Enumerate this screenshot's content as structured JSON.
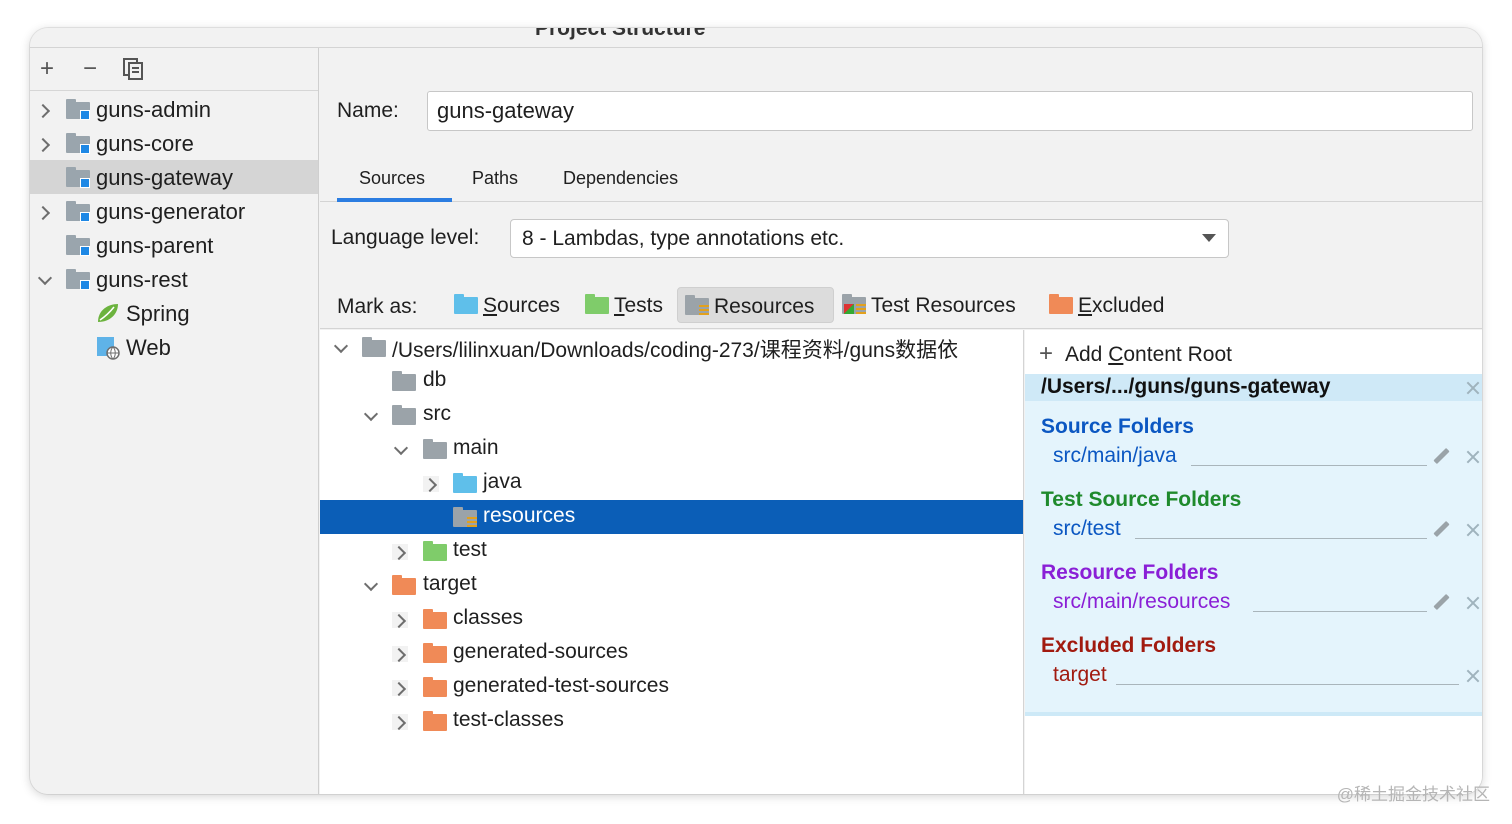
{
  "window": {
    "title": "Project Structure"
  },
  "left_toolbar": {
    "add": "+",
    "remove": "−"
  },
  "modules": [
    {
      "label": "guns-admin"
    },
    {
      "label": "guns-core"
    },
    {
      "label": "guns-gateway",
      "selected": true
    },
    {
      "label": "guns-generator"
    },
    {
      "label": "guns-parent"
    },
    {
      "label": "guns-rest"
    },
    {
      "label": "Spring"
    },
    {
      "label": "Web"
    }
  ],
  "name_field": {
    "label": "Name:",
    "value": "guns-gateway"
  },
  "tabs": [
    {
      "label": "Sources",
      "active": true
    },
    {
      "label": "Paths"
    },
    {
      "label": "Dependencies"
    }
  ],
  "language_level": {
    "label": "Language level:",
    "value": "8 - Lambdas, type annotations etc."
  },
  "mark_as": {
    "label": "Mark as:",
    "buttons": [
      {
        "mnemonic": "S",
        "rest": "ources"
      },
      {
        "mnemonic": "T",
        "rest": "ests"
      },
      {
        "mnemonic": "",
        "rest": "Resources",
        "active": true
      },
      {
        "mnemonic": "",
        "rest": "Test Resources"
      },
      {
        "mnemonic": "E",
        "rest": "xcluded"
      }
    ]
  },
  "tree": [
    {
      "label": "/Users/lilinxuan/Downloads/coding-273/课程资料/guns数据依"
    },
    {
      "label": "db"
    },
    {
      "label": "src"
    },
    {
      "label": "main"
    },
    {
      "label": "java"
    },
    {
      "label": "resources",
      "selected": true
    },
    {
      "label": "test"
    },
    {
      "label": "target"
    },
    {
      "label": "classes"
    },
    {
      "label": "generated-sources"
    },
    {
      "label": "generated-test-sources"
    },
    {
      "label": "test-classes"
    }
  ],
  "content_roots": {
    "add_label_pre": "Add ",
    "add_label_mnemonic": "C",
    "add_label_post": "ontent Root",
    "root_path": "/Users/.../guns/guns-gateway",
    "sections": [
      {
        "title": "Source Folders",
        "item": "src/main/java",
        "color": "#0b57c2"
      },
      {
        "title": "Test Source Folders",
        "item": "src/test",
        "color": "#1f8a2c"
      },
      {
        "title": "Resource Folders",
        "item": "src/main/resources",
        "color": "#8a1fd6"
      },
      {
        "title": "Excluded Folders",
        "item": "target",
        "color": "#a11a0f"
      }
    ]
  },
  "watermark": "@稀土掘金技术社区"
}
